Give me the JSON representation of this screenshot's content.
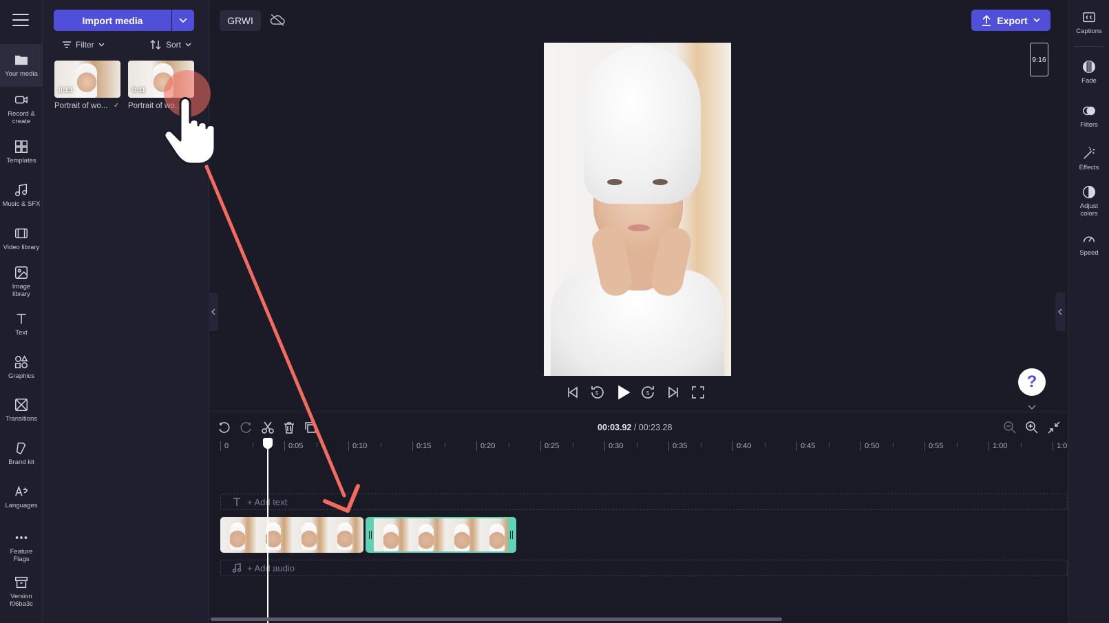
{
  "leftnav": {
    "items": [
      {
        "label": "Your media",
        "icon": "folder-icon"
      },
      {
        "label": "Record &\ncreate",
        "icon": "camera-icon"
      },
      {
        "label": "Templates",
        "icon": "templates-icon"
      },
      {
        "label": "Music & SFX",
        "icon": "music-icon"
      },
      {
        "label": "Video library",
        "icon": "film-icon"
      },
      {
        "label": "Image\nlibrary",
        "icon": "image-icon"
      },
      {
        "label": "Text",
        "icon": "text-icon"
      },
      {
        "label": "Graphics",
        "icon": "shapes-icon"
      },
      {
        "label": "Transitions",
        "icon": "transition-icon"
      },
      {
        "label": "Brand kit",
        "icon": "brand-kit-icon"
      },
      {
        "label": "Languages",
        "icon": "language-icon"
      },
      {
        "label": "Feature\nFlags",
        "icon": "more-dots-icon"
      },
      {
        "label": "Version\nf06ba3c",
        "icon": "archive-icon"
      }
    ]
  },
  "media": {
    "import_label": "Import media",
    "filter_label": "Filter",
    "sort_label": "Sort",
    "items": [
      {
        "duration": "0:13",
        "name": "Portrait of wo..."
      },
      {
        "duration": "0:11",
        "name": "Portrait of wo..."
      }
    ]
  },
  "topbar": {
    "project_name": "GRWI",
    "export_label": "Export"
  },
  "preview": {
    "aspect_ratio": "9:16"
  },
  "timeline": {
    "current_time": "00:03.92",
    "total_time": "/ 00:23.28",
    "ruler": [
      "0",
      "0:05",
      "0:10",
      "0:15",
      "0:20",
      "0:25",
      "0:30",
      "0:35",
      "0:40",
      "0:45",
      "0:50",
      "0:55",
      "1:00",
      "1:0"
    ],
    "add_text": "+ Add text",
    "add_audio": "+ Add audio"
  },
  "rightpanel": {
    "items": [
      {
        "label": "Captions",
        "icon": "captions-icon"
      },
      {
        "label": "Fade",
        "icon": "fade-icon"
      },
      {
        "label": "Filters",
        "icon": "filters-icon"
      },
      {
        "label": "Effects",
        "icon": "magic-wand-icon"
      },
      {
        "label": "Adjust\ncolors",
        "icon": "adjust-colors-icon"
      },
      {
        "label": "Speed",
        "icon": "speedometer-icon"
      }
    ]
  },
  "help": {
    "symbol": "?"
  },
  "colors": {
    "accent": "#4f4fd9",
    "clip_selected": "#5fd3b3",
    "annotation": "#f36b5e"
  }
}
